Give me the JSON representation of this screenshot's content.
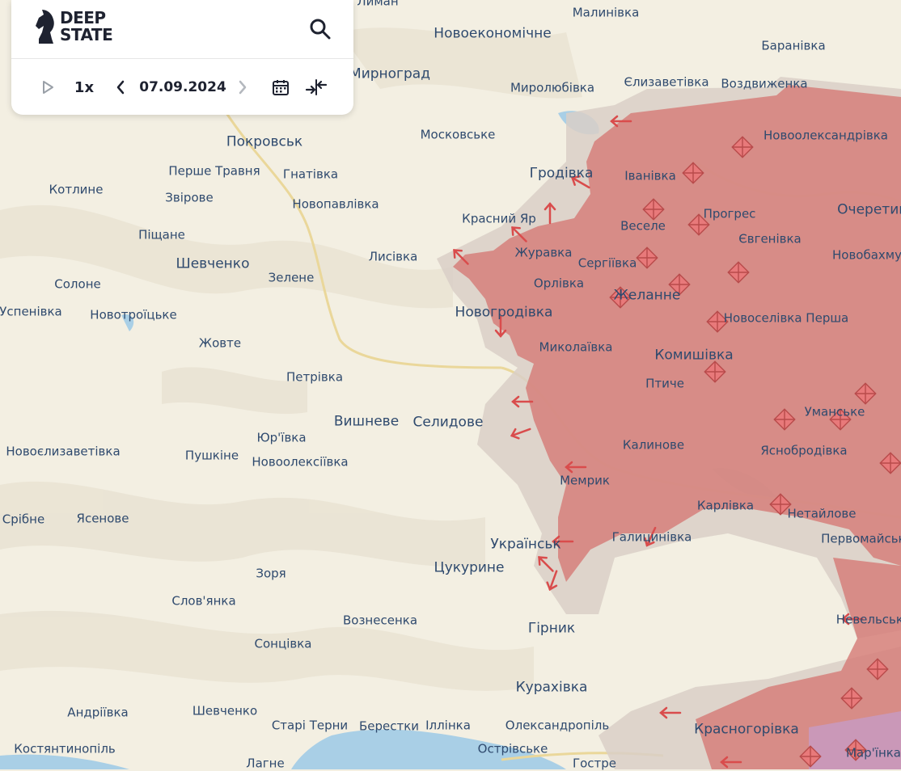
{
  "app": {
    "logo_line1": "DEEP",
    "logo_line2": "STATE"
  },
  "controls": {
    "speed": "1x",
    "date": "07.09.2024"
  },
  "icons": [
    "play-icon",
    "chevron-left-icon",
    "chevron-right-icon",
    "calendar-icon",
    "collapse-arrows-icon",
    "search-icon",
    "knight-logo-icon"
  ],
  "colors": {
    "occupied": "#d67c78",
    "contested": "#d9cfc7",
    "background": "#f3efe2",
    "water": "#a9cfe6",
    "label": "#2f4a6e",
    "arrow": "#e05a55"
  },
  "places": [
    {
      "name": "Лиман",
      "size": "s"
    },
    {
      "name": "Малинівка",
      "size": "s"
    },
    {
      "name": "Новоекономічне",
      "size": "m"
    },
    {
      "name": "Баранівка",
      "size": "s"
    },
    {
      "name": "Мирноград",
      "size": "m"
    },
    {
      "name": "Миролюбівка",
      "size": "s"
    },
    {
      "name": "Єлизаветівка",
      "size": "s"
    },
    {
      "name": "Воздвиженка",
      "size": "s"
    },
    {
      "name": "Московське",
      "size": "s"
    },
    {
      "name": "Новоолександрівка",
      "size": "s"
    },
    {
      "name": "Покровськ",
      "size": "m"
    },
    {
      "name": "Перше Травня",
      "size": "s"
    },
    {
      "name": "Гнатівка",
      "size": "s"
    },
    {
      "name": "Гродівка",
      "size": "m"
    },
    {
      "name": "Іванівка",
      "size": "s"
    },
    {
      "name": "Котлине",
      "size": "s"
    },
    {
      "name": "Звірове",
      "size": "s"
    },
    {
      "name": "Новопавлівка",
      "size": "s"
    },
    {
      "name": "Красний Яр",
      "size": "s"
    },
    {
      "name": "Веселе",
      "size": "s"
    },
    {
      "name": "Прогрес",
      "size": "s"
    },
    {
      "name": "Очеретине",
      "size": "m"
    },
    {
      "name": "Піщане",
      "size": "s"
    },
    {
      "name": "Журавка",
      "size": "s"
    },
    {
      "name": "Євгенівка",
      "size": "s"
    },
    {
      "name": "Шевченко",
      "size": "m"
    },
    {
      "name": "Лисівка",
      "size": "s"
    },
    {
      "name": "Сергіївка",
      "size": "s"
    },
    {
      "name": "Новобахмутівка",
      "size": "s"
    },
    {
      "name": "Зелене",
      "size": "s"
    },
    {
      "name": "Солоне",
      "size": "s"
    },
    {
      "name": "Орлівка",
      "size": "s"
    },
    {
      "name": "Желанне",
      "size": "m"
    },
    {
      "name": "Успенівка",
      "size": "s"
    },
    {
      "name": "Новотроїцьке",
      "size": "s"
    },
    {
      "name": "Новогродівка",
      "size": "m"
    },
    {
      "name": "Новоселівка Перша",
      "size": "s"
    },
    {
      "name": "Жовте",
      "size": "s"
    },
    {
      "name": "Миколаївка",
      "size": "s"
    },
    {
      "name": "Комишівка",
      "size": "m"
    },
    {
      "name": "Петрівка",
      "size": "s"
    },
    {
      "name": "Птиче",
      "size": "s"
    },
    {
      "name": "Вишневе",
      "size": "m"
    },
    {
      "name": "Селидове",
      "size": "m"
    },
    {
      "name": "Уманське",
      "size": "s"
    },
    {
      "name": "Юр'ївка",
      "size": "s"
    },
    {
      "name": "Новоєлизаветівка",
      "size": "s"
    },
    {
      "name": "Пушкіне",
      "size": "s"
    },
    {
      "name": "Калинове",
      "size": "s"
    },
    {
      "name": "Яснобродівка",
      "size": "s"
    },
    {
      "name": "Новоолексіївка",
      "size": "s"
    },
    {
      "name": "Мемрик",
      "size": "s"
    },
    {
      "name": "Срібне",
      "size": "s"
    },
    {
      "name": "Ясенове",
      "size": "s"
    },
    {
      "name": "Карлівка",
      "size": "s"
    },
    {
      "name": "Нетайлове",
      "size": "s"
    },
    {
      "name": "Первомайське",
      "size": "s"
    },
    {
      "name": "Українськ",
      "size": "m"
    },
    {
      "name": "Галицинівка",
      "size": "s"
    },
    {
      "name": "Цукурине",
      "size": "m"
    },
    {
      "name": "Зоря",
      "size": "s"
    },
    {
      "name": "Слов'янка",
      "size": "s"
    },
    {
      "name": "Вознесенка",
      "size": "s"
    },
    {
      "name": "Гірник",
      "size": "m"
    },
    {
      "name": "Невельське",
      "size": "s"
    },
    {
      "name": "Сонцівка",
      "size": "s"
    },
    {
      "name": "Курахівка",
      "size": "m"
    },
    {
      "name": "Андріївка",
      "size": "s"
    },
    {
      "name": "Шевченко",
      "size": "s"
    },
    {
      "name": "Старі Терни",
      "size": "s"
    },
    {
      "name": "Берестки",
      "size": "s"
    },
    {
      "name": "Іллінка",
      "size": "s"
    },
    {
      "name": "Олександропіль",
      "size": "s"
    },
    {
      "name": "Красногорівка",
      "size": "m"
    },
    {
      "name": "Костянтинопіль",
      "size": "s"
    },
    {
      "name": "Острівське",
      "size": "s"
    },
    {
      "name": "Гостре",
      "size": "s"
    },
    {
      "name": "Лагне",
      "size": "s"
    },
    {
      "name": "Мар'їнка",
      "size": "s"
    }
  ]
}
